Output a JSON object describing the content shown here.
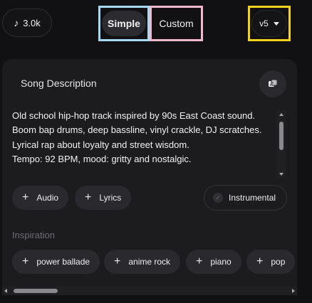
{
  "topbar": {
    "credits": {
      "icon": "music-note-icon",
      "value": "3.0k"
    },
    "modes": {
      "simple_label": "Simple",
      "custom_label": "Custom",
      "selected": "Simple"
    },
    "version": {
      "label": "v5",
      "icon": "chevron-down-icon"
    }
  },
  "panel": {
    "title": "Song Description",
    "dice_icon": "dice-icon",
    "description": "Old school hip-hop track inspired by 90s East Coast sound.\nBoom bap drums, deep bassline, vinyl crackle, DJ scratches.\nLyrical rap about loyalty and street wisdom.\nTempo: 92 BPM, mood: gritty and nostalgic.",
    "add_buttons": {
      "audio_label": "Audio",
      "lyrics_label": "Lyrics"
    },
    "instrumental": {
      "label": "Instrumental",
      "enabled": false
    },
    "inspiration": {
      "label": "Inspiration",
      "chips": [
        "power ballade",
        "anime rock",
        "piano",
        "pop"
      ]
    }
  },
  "colors": {
    "highlight_simple": "#a9d8f2",
    "highlight_custom": "#f3b8cc",
    "highlight_version": "#f2d21c",
    "panel_bg": "#1c1c1f",
    "chip_bg": "#2a2a2e"
  }
}
